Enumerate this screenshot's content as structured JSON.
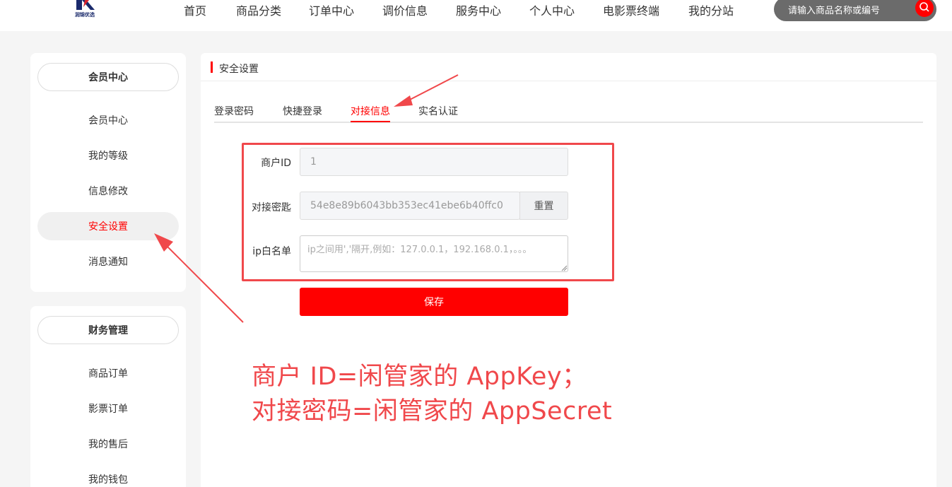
{
  "nav": {
    "items": [
      "首页",
      "商品分类",
      "订单中心",
      "调价信息",
      "服务中心",
      "个人中心",
      "电影票终端",
      "我的分站"
    ],
    "search_placeholder": "请输入商品名称或编号",
    "logo_text": "润锦优选"
  },
  "sidebar": {
    "member": {
      "title": "会员中心",
      "items": [
        "会员中心",
        "我的等级",
        "信息修改",
        "安全设置",
        "消息通知"
      ],
      "active": "安全设置"
    },
    "finance": {
      "title": "财务管理",
      "items": [
        "商品订单",
        "影票订单",
        "我的售后",
        "我的钱包"
      ]
    }
  },
  "main": {
    "title": "安全设置",
    "tabs": [
      "登录密码",
      "快捷登录",
      "对接信息",
      "实名认证"
    ],
    "active_tab": "对接信息",
    "form": {
      "merchant_id_label": "商户ID",
      "merchant_id_value": "1",
      "secret_label": "对接密匙",
      "secret_value": "54e8e89b6043bb353ec41ebe6b40ffc0",
      "reset_label": "重置",
      "ip_label": "ip白名单",
      "ip_placeholder": "ip之间用','隔开,例如：127.0.0.1，192.168.0.1，。。。",
      "save_label": "保存"
    }
  },
  "annotation": {
    "line1": "商户 ID=闲管家的 AppKey；",
    "line2": "对接密码=闲管家的 AppSecret",
    "color": "#f0484b"
  },
  "colors": {
    "accent": "#ff0000",
    "annotation": "#f0484b"
  }
}
